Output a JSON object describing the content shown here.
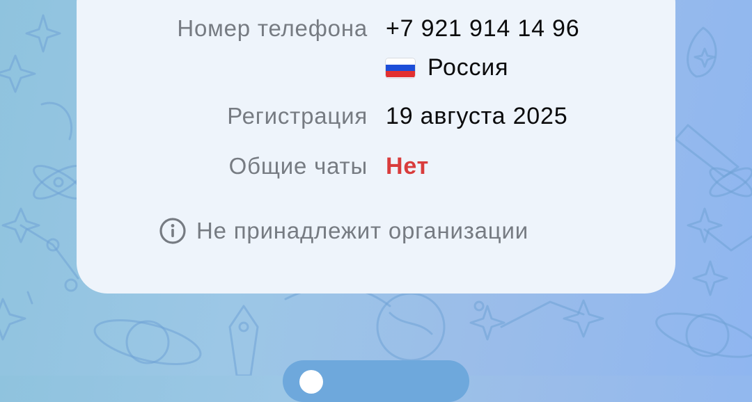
{
  "profile_info": {
    "phone": {
      "label": "Номер телефона",
      "value": "+7 921 914 14 96",
      "country_flag_icon": "russia-flag-icon",
      "country": "Россия"
    },
    "registration": {
      "label": "Регистрация",
      "value": "19 августа 2025"
    },
    "common_chats": {
      "label": "Общие чаты",
      "value": "Нет",
      "value_color": "#d93c3c"
    },
    "organization": {
      "icon": "info-icon",
      "text": "Не принадлежит организации"
    }
  },
  "colors": {
    "card_background": "#eef4fb",
    "label_gray": "#767b82",
    "accent_blue": "#6ea8dc"
  }
}
